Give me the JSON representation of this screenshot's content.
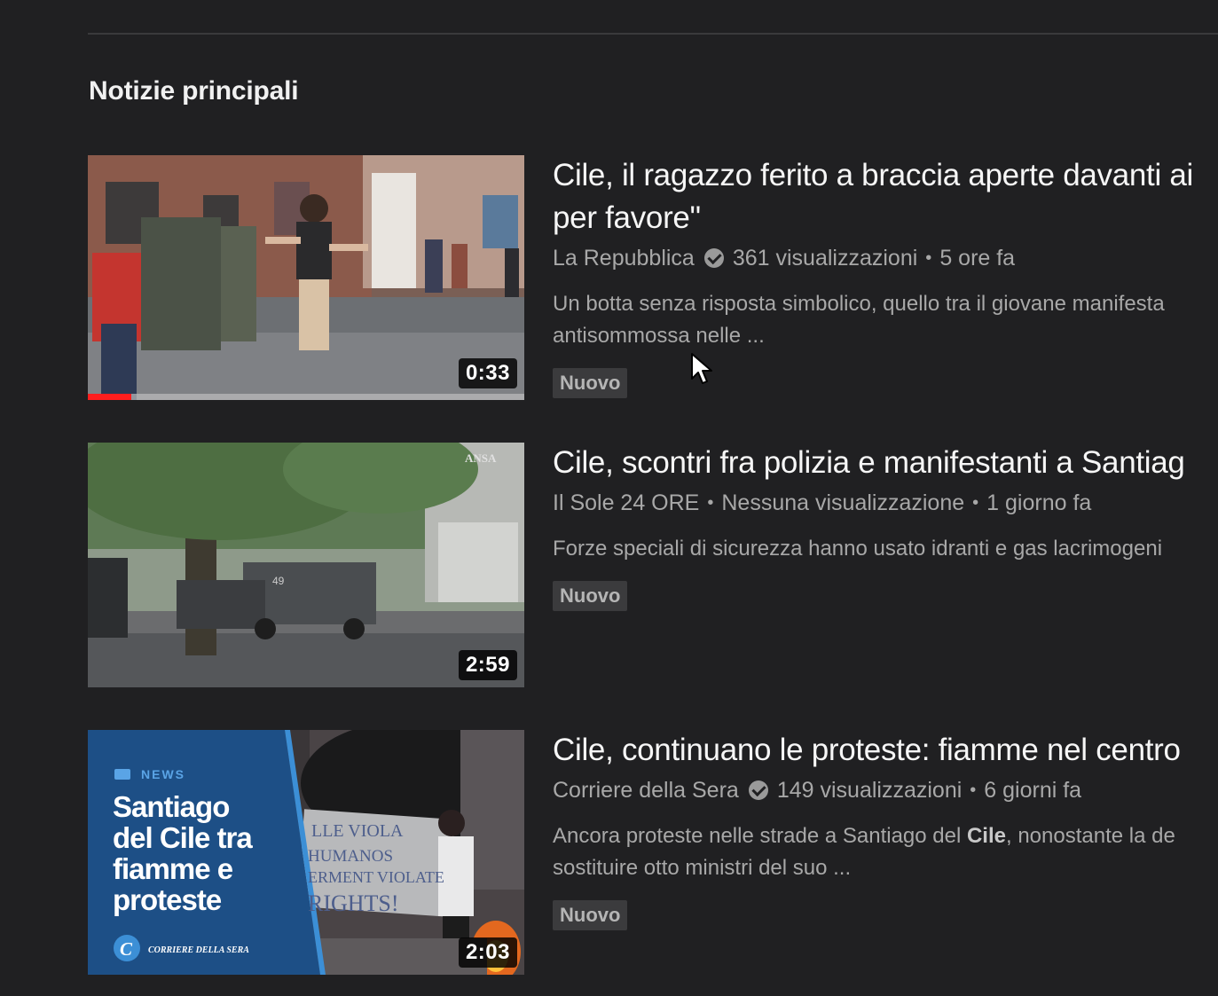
{
  "section": {
    "title": "Notizie principali"
  },
  "videos": [
    {
      "title": "Cile, il ragazzo ferito a braccia aperte davanti ai\nper favore\"",
      "channel": "La Repubblica",
      "verified": true,
      "views": "361 visualizzazioni",
      "age": "5 ore fa",
      "description": "Un botta senza risposta simbolico, quello tra il giovane manifesta\nantisommossa nelle ...",
      "badge": "Nuovo",
      "duration": "0:33",
      "watched_fraction": 0.1
    },
    {
      "title": "Cile, scontri fra polizia e manifestanti a Santiag",
      "channel": "Il Sole 24 ORE",
      "verified": false,
      "views": "Nessuna visualizzazione",
      "age": "1 giorno fa",
      "description": "Forze speciali di sicurezza hanno usato idranti e gas lacrimogeni",
      "badge": "Nuovo",
      "duration": "2:59",
      "thumb_watermark": "ANSA",
      "thumb_vehicle_number": "49"
    },
    {
      "title": "Cile, continuano le proteste: fiamme nel centro",
      "channel": "Corriere della Sera",
      "verified": true,
      "views": "149 visualizzazioni",
      "age": "6 giorni fa",
      "description_before": "Ancora proteste nelle strade a Santiago del ",
      "description_bold": "Cile",
      "description_after": ", nonostante la de\nsostituire otto ministri del suo ...",
      "badge": "Nuovo",
      "duration": "2:03",
      "thumb_tag": "NEWS",
      "thumb_headline": [
        "Santiago",
        "del Cile tra",
        "fiamme e",
        "proteste"
      ],
      "thumb_brand": "CORRIERE DELLA SERA",
      "thumb_brand_letter": "C",
      "thumb_sign_lines": [
        "LLE VIOLA",
        "HUMANOS",
        "ERMENT VIOLATE",
        "RIGHTS!"
      ]
    }
  ],
  "colors": {
    "background": "#202022",
    "progress": "#ff1e1e",
    "thumb3_panel": "#1d4f86"
  }
}
